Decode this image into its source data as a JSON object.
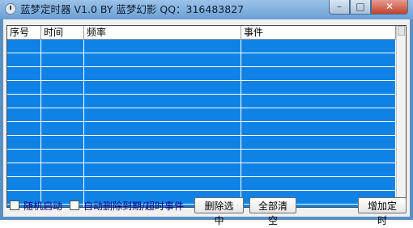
{
  "window": {
    "title": "蓝梦定时器 V1.0 BY 蓝梦幻影 QQ：316483827",
    "controls": {
      "minimize": "–",
      "maximize": "□",
      "close": "✕"
    }
  },
  "table": {
    "columns": [
      "序号",
      "时间",
      "频率",
      "事件"
    ],
    "rows": []
  },
  "footer": {
    "random_start": "随机启动",
    "auto_delete": "自动删除到期/超时事件",
    "delete_selected": "删除选中",
    "clear_all": "全部清空",
    "add_timer": "增加定时"
  }
}
